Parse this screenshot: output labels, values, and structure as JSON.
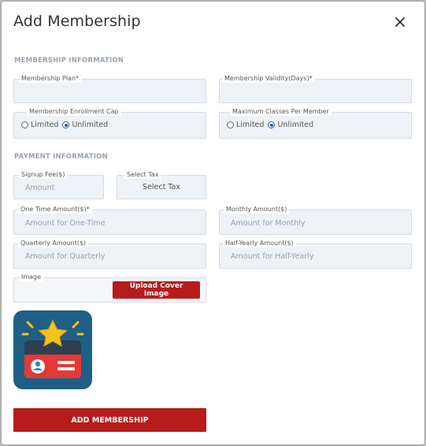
{
  "modal": {
    "title": "Add Membership",
    "close_icon": "close-icon"
  },
  "sections": {
    "membership_info": "MEMBERSHIP INFORMATION",
    "payment_info": "PAYMENT INFORMATION"
  },
  "fields": {
    "membership_plan": {
      "label": "Membership Plan*",
      "value": "",
      "placeholder": ""
    },
    "membership_validity": {
      "label": "Membership Validity(Days)*",
      "value": "",
      "placeholder": ""
    },
    "enrollment_cap": {
      "label": "Membership Enrollment Cap",
      "options": [
        "Limited",
        "Unlimited"
      ],
      "selected": "Unlimited"
    },
    "max_classes": {
      "label": "Maximum Classes Per Member",
      "options": [
        "Limited",
        "Unlimited"
      ],
      "selected": "Unlimited"
    },
    "signup_fee": {
      "label": "Signup Fee($)",
      "placeholder": "Amount"
    },
    "select_tax": {
      "label": "Select Tax",
      "button_label": "Select Tax"
    },
    "one_time_amount": {
      "label": "One Time Amount($)*",
      "placeholder": "Amount for One-Time"
    },
    "monthly_amount": {
      "label": "Monthly Amount($)",
      "placeholder": "Amount for Monthly"
    },
    "quarterly_amount": {
      "label": "Quarterly Amount($)",
      "placeholder": "Amount for Quarterly"
    },
    "half_yearly_amount": {
      "label": "Half-Yearly Amount($)",
      "placeholder": "Amount for Half-Yearly"
    },
    "image": {
      "label": "Image",
      "upload_label": "Upload Cover Image"
    }
  },
  "cover_image": {
    "icon": "membership-card-icon",
    "colors": {
      "bg": "#1e5f85",
      "star": "#f6c21c",
      "card": "#2e3f50",
      "stripe": "#e53935"
    }
  },
  "submit": {
    "label": "ADD MEMBERSHIP"
  },
  "colors": {
    "accent": "#b71c1c",
    "field_bg": "#eef2f7",
    "section": "#9aa3ad",
    "radio": "#2b5fa3"
  }
}
